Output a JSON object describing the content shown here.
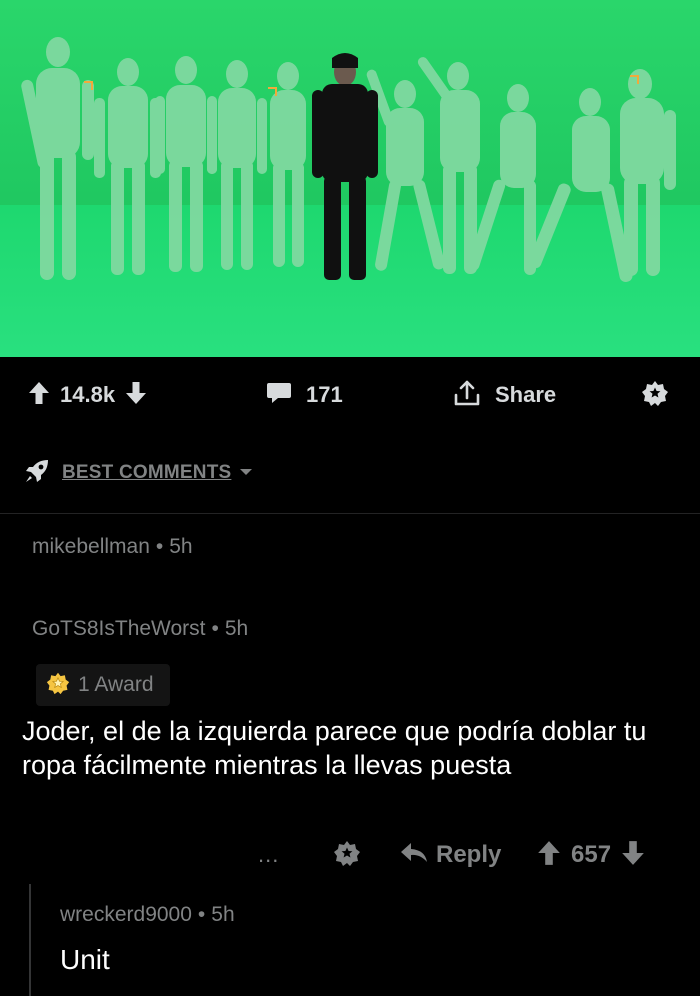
{
  "post": {
    "image": {
      "description_icon": "image-photo",
      "bg": "#2fcf6a",
      "floor": "#25d57a"
    },
    "upvote_count": "14.8k",
    "comment_count": "171",
    "share_label": "Share"
  },
  "sort": {
    "label": "BEST COMMENTS"
  },
  "comments": [
    {
      "author": "mikebellman",
      "dot": "•",
      "age": "5h"
    },
    {
      "author": "GoTS8IsTheWorst",
      "dot": "•",
      "age": "5h",
      "award_label": "1 Award",
      "body": "Joder, el de la izquierda parece que podría doblar tu ropa fácilmente mientras la llevas puesta",
      "more_label": "...",
      "reply_label": "Reply",
      "score": "657",
      "replies": [
        {
          "author": "wreckerd9000",
          "dot": "•",
          "age": "5h",
          "body": "Unit"
        }
      ]
    }
  ],
  "colors": {
    "muted": "#818384",
    "text": "#d7dadc",
    "white": "#ffffff",
    "bg": "#000000"
  }
}
